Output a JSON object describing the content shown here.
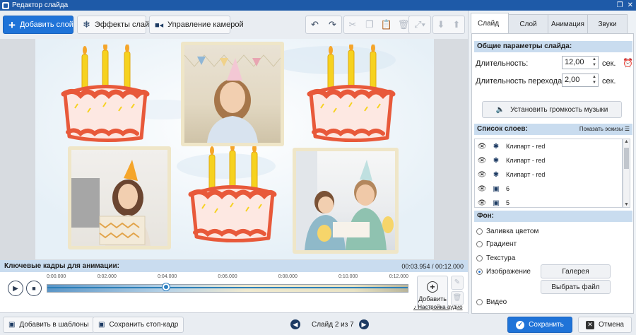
{
  "window": {
    "title": "Редактор слайда"
  },
  "toolbar": {
    "add_layer": "Добавить слой",
    "slide_effects": "Эффекты слайда",
    "camera_control": "Управление камерой"
  },
  "keyframes": {
    "title": "Ключевые кадры для анимации:",
    "time": "00:03.954 / 00:12.000",
    "ruler": [
      "0:00.000",
      "0:02.000",
      "0:04.000",
      "0:06.000",
      "0:08.000",
      "0:10.000",
      "0:12.000"
    ],
    "position_seconds": 3.954,
    "duration_seconds": 12.0,
    "add_label": "Добавить",
    "music_link": "Настройка аудио"
  },
  "bottom": {
    "add_to_templates": "Добавить в шаблоны",
    "save_frame": "Сохранить стоп-кадр",
    "slide_counter": "Слайд 2 из 7",
    "save": "Сохранить",
    "cancel": "Отмена"
  },
  "tabs": [
    "Слайд",
    "Слой",
    "Анимация",
    "Звуки"
  ],
  "panel": {
    "general_title": "Общие параметры слайда:",
    "duration_label": "Длительность:",
    "duration_value": "12,00",
    "transition_label": "Длительность перехода:",
    "transition_value": "2,00",
    "unit": "сек.",
    "music_volume": "Установить громкость музыки",
    "layers_title": "Список слоев:",
    "show_thumbs": "Показать эскизы",
    "layers": [
      {
        "label": "Клипарт - red",
        "icon": "clipart-icon"
      },
      {
        "label": "Клипарт - red",
        "icon": "clipart-icon"
      },
      {
        "label": "Клипарт - red",
        "icon": "clipart-icon"
      },
      {
        "label": "6",
        "icon": "image-icon"
      },
      {
        "label": "5",
        "icon": "image-icon"
      }
    ],
    "bg_title": "Фон:",
    "bg_options": [
      "Заливка цветом",
      "Градиент",
      "Текстура",
      "Изображение",
      "Видео"
    ],
    "bg_selected": "Изображение",
    "gallery": "Галерея",
    "choose_file": "Выбрать файл"
  },
  "colors": {
    "accent": "#1f73d8",
    "section": "#c9dcef",
    "cake_red": "#e8593a",
    "candle": "#f6d21f"
  }
}
